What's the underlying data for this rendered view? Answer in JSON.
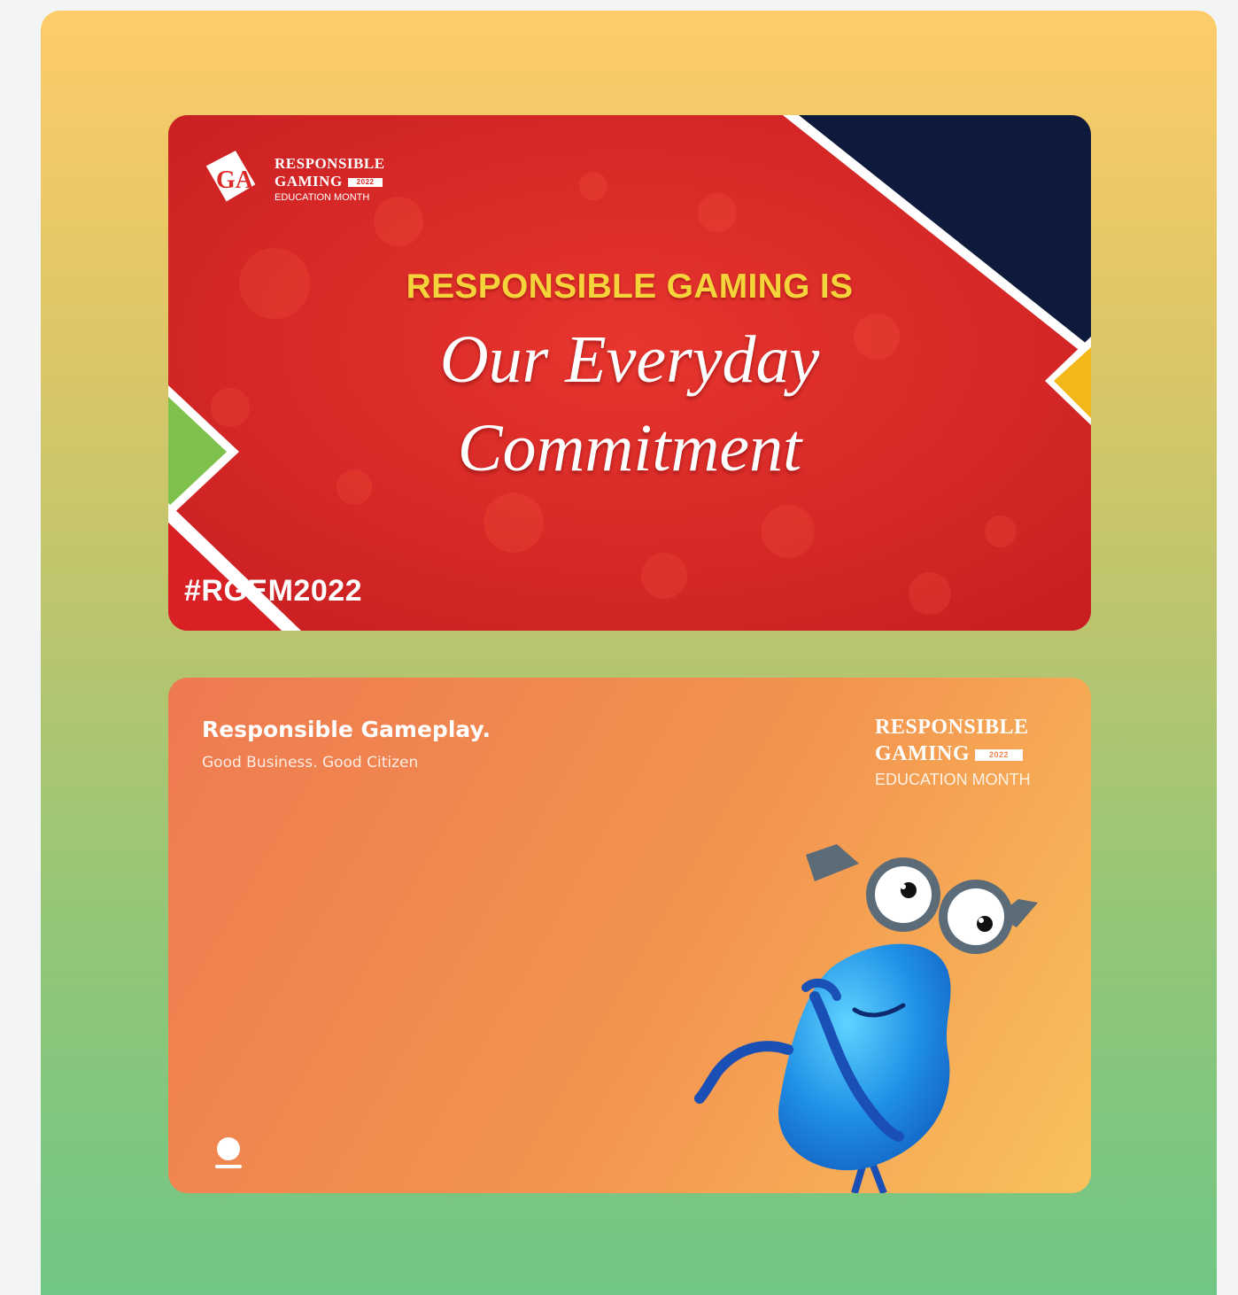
{
  "banner_rgem": {
    "logo": {
      "line1": "RESPONSIBLE",
      "line2": "GAMING",
      "year": "2022",
      "line3": "EDUCATION MONTH"
    },
    "headline_top": "RESPONSIBLE GAMING IS",
    "headline_line2": "Our Everyday",
    "headline_line3": "Commitment",
    "hashtag": "#RGEM2022",
    "colors": {
      "background": "#dd2a27",
      "navy": "#0e1a3c",
      "yellow": "#f2b817",
      "green": "#7fc14d",
      "headline_accent": "#f5d33a"
    }
  },
  "banner_gameplay": {
    "title": "Responsible Gameplay.",
    "subtitle": "Good Business. Good Citizen",
    "logo": {
      "line1": "RESPONSIBLE",
      "line2": "GAMING",
      "year": "2022",
      "line3": "EDUCATION MONTH"
    },
    "colors": {
      "gradient_start": "#ee7a50",
      "gradient_end": "#f9c25c",
      "mascot_body": "#1f8fe6"
    },
    "icons": [
      "person-icon",
      "mascot-character"
    ]
  }
}
